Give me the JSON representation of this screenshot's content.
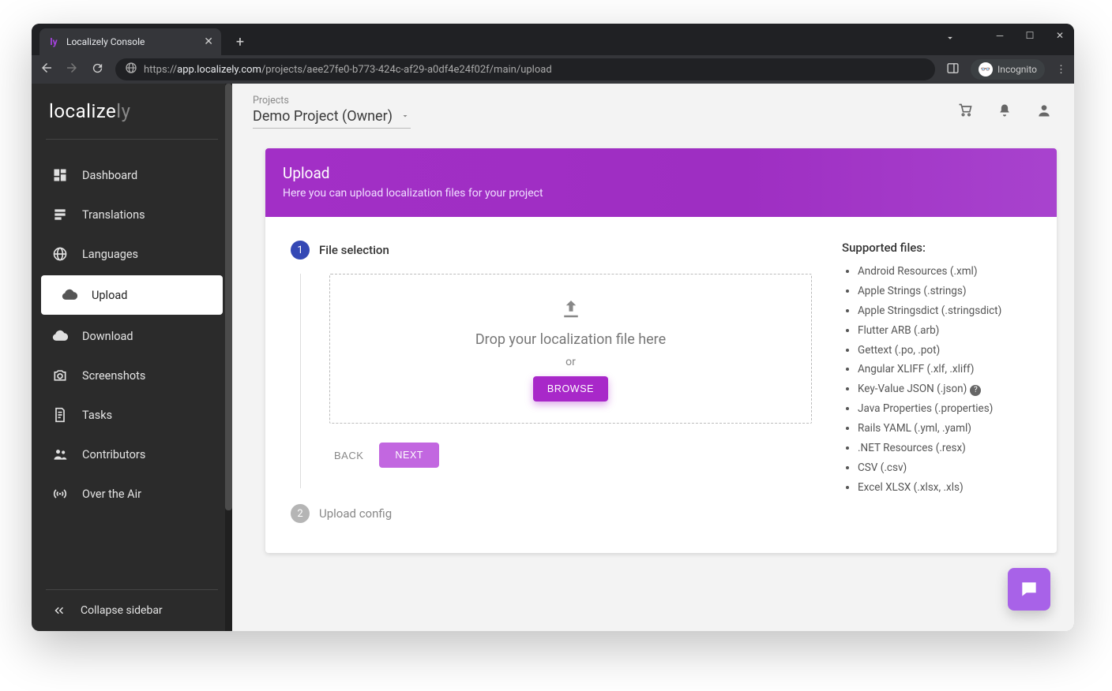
{
  "browser": {
    "tab_title": "Localizely Console",
    "url_prefix": "https://",
    "url_host": "app.localizely.com",
    "url_path": "/projects/aee27fe0-b773-424c-af29-a0df4e24f02f/main/upload",
    "incognito_label": "Incognito"
  },
  "logo": {
    "part1": "localize",
    "part2": "ly"
  },
  "sidebar": {
    "items": [
      {
        "label": "Dashboard"
      },
      {
        "label": "Translations"
      },
      {
        "label": "Languages"
      },
      {
        "label": "Upload"
      },
      {
        "label": "Download"
      },
      {
        "label": "Screenshots"
      },
      {
        "label": "Tasks"
      },
      {
        "label": "Contributors"
      },
      {
        "label": "Over the Air"
      }
    ],
    "collapse_label": "Collapse sidebar"
  },
  "header": {
    "breadcrumb": "Projects",
    "project_name": "Demo Project (Owner)"
  },
  "banner": {
    "title": "Upload",
    "subtitle": "Here you can upload localization files for your project"
  },
  "steps": {
    "one_num": "1",
    "one_label": "File selection",
    "two_num": "2",
    "two_label": "Upload config"
  },
  "dropzone": {
    "text": "Drop your localization file here",
    "or": "or",
    "browse_label": "BROWSE"
  },
  "buttons": {
    "back": "BACK",
    "next": "NEXT"
  },
  "supported": {
    "title": "Supported files:",
    "items": [
      "Android Resources (.xml)",
      "Apple Strings (.strings)",
      "Apple Stringsdict (.stringsdict)",
      "Flutter ARB (.arb)",
      "Gettext (.po, .pot)",
      "Angular XLIFF (.xlf, .xliff)",
      "Key-Value JSON (.json)",
      "Java Properties (.properties)",
      "Rails YAML (.yml, .yaml)",
      ".NET Resources (.resx)",
      "CSV (.csv)",
      "Excel XLSX (.xlsx, .xls)"
    ]
  }
}
